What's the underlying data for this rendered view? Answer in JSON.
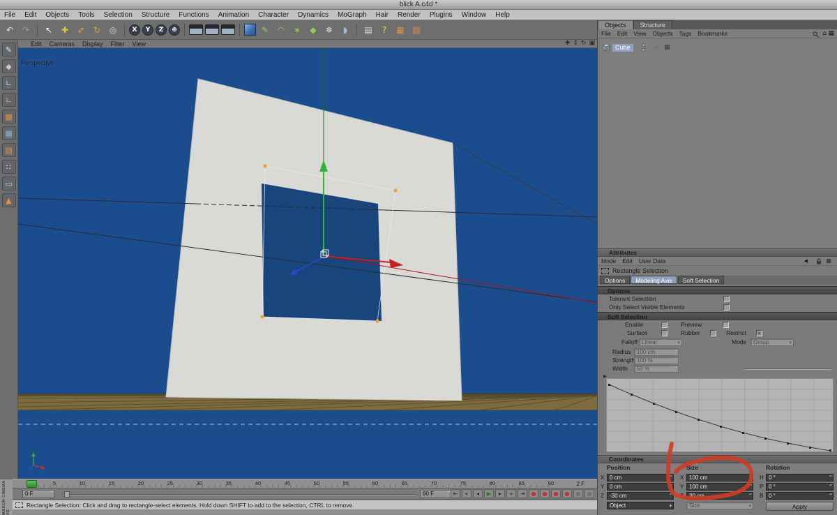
{
  "window": {
    "title": "blick A.c4d *"
  },
  "menubar": {
    "items": [
      "File",
      "Edit",
      "Objects",
      "Tools",
      "Selection",
      "Structure",
      "Functions",
      "Animation",
      "Character",
      "Dynamics",
      "MoGraph",
      "Hair",
      "Render",
      "Plugins",
      "Window",
      "Help"
    ]
  },
  "toolbar": {
    "tools": [
      {
        "name": "undo-icon",
        "glyph": "↶",
        "color": "#e2e2e2"
      },
      {
        "name": "redo-icon",
        "glyph": "↷",
        "color": "#9f9f9f"
      },
      {
        "name": "toolbar-separator",
        "glyph": "",
        "cls": "sep",
        "interactable": "false"
      },
      {
        "name": "live-selection-tool-icon",
        "glyph": "↖",
        "color": "#ffffff"
      },
      {
        "name": "move-tool-icon",
        "glyph": "✚",
        "color": "#e6c832"
      },
      {
        "name": "scale-tool-icon",
        "glyph": "↔",
        "color": "#e6a032",
        "cls": "rot45"
      },
      {
        "name": "rotate-tool-icon",
        "glyph": "↻",
        "color": "#e6a032"
      },
      {
        "name": "last-tool-icon",
        "glyph": "◎",
        "color": "#d6d6d6"
      },
      {
        "name": "toolbar-separator",
        "glyph": "",
        "cls": "sep",
        "interactable": "false"
      },
      {
        "name": "lock-x-axis-icon",
        "glyph": "X",
        "cls": "circle"
      },
      {
        "name": "lock-y-axis-icon",
        "glyph": "Y",
        "cls": "circle"
      },
      {
        "name": "lock-z-axis-icon",
        "glyph": "Z",
        "cls": "circle"
      },
      {
        "name": "coordinate-system-icon",
        "glyph": "⊕",
        "cls": "circle"
      },
      {
        "name": "toolbar-separator",
        "glyph": "",
        "cls": "sep",
        "interactable": "false"
      },
      {
        "name": "render-view-icon",
        "glyph": "",
        "cls": "clapper"
      },
      {
        "name": "render-region-icon",
        "glyph": "",
        "cls": "clapper"
      },
      {
        "name": "render-settings-icon",
        "glyph": "",
        "cls": "clapper"
      },
      {
        "name": "toolbar-separator",
        "glyph": "",
        "cls": "sep",
        "interactable": "false"
      },
      {
        "name": "add-primitive-cube-icon",
        "glyph": "",
        "cls": "cube3d"
      },
      {
        "name": "add-spline-icon",
        "glyph": "✎",
        "color": "#8fd14f"
      },
      {
        "name": "add-nurbs-icon",
        "glyph": "◠",
        "color": "#8fd14f"
      },
      {
        "name": "add-modeling-object-icon",
        "glyph": "∗",
        "color": "#8fd14f"
      },
      {
        "name": "add-deformer-icon",
        "glyph": "◆",
        "color": "#8fd14f"
      },
      {
        "name": "add-particles-icon",
        "glyph": "❄",
        "color": "#cfe4f5"
      },
      {
        "name": "add-scene-object-icon",
        "glyph": "◗",
        "color": "#9fb8dd"
      },
      {
        "name": "toolbar-separator",
        "glyph": "",
        "cls": "sep",
        "interactable": "false"
      },
      {
        "name": "snap-settings-icon",
        "glyph": "▤",
        "color": "#d8d8d8"
      },
      {
        "name": "help-icon",
        "glyph": "?",
        "color": "#f0d840"
      },
      {
        "name": "display-mode-icon",
        "glyph": "▦",
        "color": "#e09040"
      },
      {
        "name": "texture-view-icon",
        "glyph": "▧",
        "color": "#e09040"
      }
    ]
  },
  "left_toolbar": {
    "tools": [
      {
        "name": "make-editable-icon",
        "glyph": "✎",
        "color": "#e0e0e0"
      },
      {
        "name": "model-mode-icon",
        "glyph": "◆",
        "color": "#c8c8c8"
      },
      {
        "name": "texture-axis-mode-icon",
        "glyph": "∟",
        "color": "#c8c8c8"
      },
      {
        "name": "object-axis-mode-icon",
        "glyph": "∟",
        "color": "#d8a868"
      },
      {
        "name": "points-mode-icon",
        "glyph": "▦",
        "color": "#e09040"
      },
      {
        "name": "edges-mode-icon",
        "glyph": "▦",
        "color": "#8fb0d8"
      },
      {
        "name": "polygons-mode-icon",
        "glyph": "▧",
        "color": "#e09040"
      },
      {
        "name": "select-points-icon",
        "glyph": "∷",
        "color": "#eeeeee"
      },
      {
        "name": "select-edges-icon",
        "glyph": "▭",
        "color": "#c8c8c8"
      },
      {
        "name": "select-polygons-icon",
        "glyph": "▲",
        "color": "#e09040"
      }
    ]
  },
  "viewport": {
    "label": "Perspective",
    "menu": [
      "Edit",
      "Cameras",
      "Display",
      "Filter",
      "View"
    ],
    "view_icons": [
      {
        "name": "pan-view-icon",
        "glyph": "✚"
      },
      {
        "name": "zoom-view-icon",
        "glyph": "⇕"
      },
      {
        "name": "rotate-view-icon",
        "glyph": "↻"
      },
      {
        "name": "maximize-view-icon",
        "glyph": "▣"
      }
    ],
    "colors": {
      "background": "#1b4d8e",
      "object": "#d9d9d5",
      "selection": "#f0a030",
      "axis_x": "#c42020",
      "axis_y": "#35b335",
      "axis_z": "#2a46c8",
      "ground": "#7c6b3e"
    }
  },
  "object_manager": {
    "tabs": [
      "Objects",
      "Structure"
    ],
    "menu": [
      "File",
      "Edit",
      "View",
      "Objects",
      "Tags",
      "Bookmarks"
    ],
    "icons": {
      "home": "⌂",
      "grid": "▦",
      "check": "✓"
    },
    "object": {
      "label": "Cube"
    }
  },
  "attributes": {
    "title": "Attributes",
    "menu": [
      "Mode",
      "Edit",
      "User Data"
    ],
    "tool_name": "Rectangle Selection",
    "tabs": [
      "Options",
      "Modeling Axis",
      "Soft Selection"
    ],
    "options": {
      "header": "Options",
      "tolerant_label": "Tolerant Selection",
      "visible_label": "Only Select Visible Elements"
    },
    "soft": {
      "header": "Soft Selection",
      "enable": "Enable",
      "preview": "Preview",
      "surface": "Surface",
      "rubber": "Rubber",
      "restrict": "Restrict",
      "falloff": "Falloff",
      "falloff_value": "Linear",
      "mode": "Mode",
      "mode_value": "Group",
      "radius": "Radius",
      "radius_value": "100 cm",
      "strength": "Strength",
      "strength_value": "100 %",
      "width": "Width",
      "width_value": "50 %"
    }
  },
  "coordinates": {
    "title": "Coordinates",
    "columns": [
      "Position",
      "Size",
      "Rotation"
    ],
    "position": {
      "x_label": "X",
      "x": "0 cm",
      "y_label": "Y",
      "y": "0 cm",
      "z_label": "Z",
      "z": "-30 cm"
    },
    "size": {
      "x_label": "X",
      "x": "100 cm",
      "y_label": "Y",
      "y": "100 cm",
      "z_label": "Z",
      "z": "30 cm"
    },
    "rotation": {
      "h_label": "H",
      "h": "0 °",
      "p_label": "P",
      "p": "0 °",
      "b_label": "B",
      "b": "0 °"
    },
    "object_mode": "Object",
    "size_mode": "Size",
    "apply": "Apply"
  },
  "timeline": {
    "ticks": [
      "0",
      "5",
      "10",
      "15",
      "20",
      "25",
      "30",
      "35",
      "40",
      "45",
      "50",
      "55",
      "60",
      "65",
      "70",
      "75",
      "80",
      "85",
      "90"
    ],
    "current_frame": "2 F",
    "start_frame": "0 F",
    "end_frame": "90 F",
    "transport": [
      {
        "name": "goto-start-button",
        "glyph": "⇤"
      },
      {
        "name": "prev-key-button",
        "glyph": "«"
      },
      {
        "name": "prev-frame-button",
        "glyph": "◂"
      },
      {
        "name": "play-forward-button",
        "glyph": "▶",
        "color": "#1f7f1f"
      },
      {
        "name": "next-frame-button",
        "glyph": "▸"
      },
      {
        "name": "next-key-button",
        "glyph": "»"
      },
      {
        "name": "goto-end-button",
        "glyph": "⇥"
      },
      {
        "name": "record-keyframe-button",
        "glyph": "●",
        "color": "#c23322"
      },
      {
        "name": "record-position-button",
        "glyph": "●",
        "color": "#c23322"
      },
      {
        "name": "record-scale-button",
        "glyph": "●",
        "color": "#c23322"
      },
      {
        "name": "record-rotation-button",
        "glyph": "●",
        "color": "#c23322"
      },
      {
        "name": "record-parameters-button",
        "glyph": "●",
        "color": "#6f6f6f"
      },
      {
        "name": "record-pla-button",
        "glyph": "●",
        "color": "#6f6f6f"
      }
    ]
  },
  "statusbar": {
    "text": "Rectangle Selection: Click and drag to rectangle-select elements. Hold down SHIFT to add to the selection, CTRL to remove."
  },
  "branding": {
    "text": "MAXON CINEMA 4D"
  },
  "ui": {
    "dropdown_arrow": "▾",
    "stepper": "▴▾",
    "check": "×",
    "expander": "▶",
    "back": "◀"
  },
  "annotation": {
    "color": "#d23b25"
  }
}
